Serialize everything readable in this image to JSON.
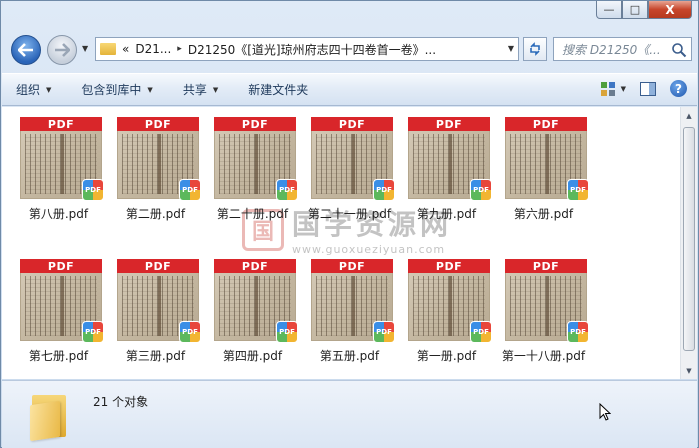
{
  "window": {
    "minimize_label": "—",
    "maximize_label": "□",
    "close_label": "X"
  },
  "address_bar": {
    "chevron": "«",
    "crumbs": [
      "D21...",
      "D21250《[道光]琼州府志四十四卷首一卷》..."
    ],
    "separator": "▸",
    "dropdown": "▼"
  },
  "search": {
    "placeholder": "搜索 D21250《..."
  },
  "toolbar": {
    "organize": "组织",
    "include_library": "包含到库中",
    "share": "共享",
    "new_folder": "新建文件夹",
    "caret": "▼",
    "help": "?"
  },
  "files": [
    {
      "name": "第八册.pdf",
      "banner": "PDF",
      "badge": "PDF"
    },
    {
      "name": "第二册.pdf",
      "banner": "PDF",
      "badge": "PDF"
    },
    {
      "name": "第二十册.pdf",
      "banner": "PDF",
      "badge": "PDF"
    },
    {
      "name": "第二十一册.pdf",
      "banner": "PDF",
      "badge": "PDF"
    },
    {
      "name": "第九册.pdf",
      "banner": "PDF",
      "badge": "PDF"
    },
    {
      "name": "第六册.pdf",
      "banner": "PDF",
      "badge": "PDF"
    },
    {
      "name": "第七册.pdf",
      "banner": "PDF",
      "badge": "PDF"
    },
    {
      "name": "第三册.pdf",
      "banner": "PDF",
      "badge": "PDF"
    },
    {
      "name": "第四册.pdf",
      "banner": "PDF",
      "badge": "PDF"
    },
    {
      "name": "第五册.pdf",
      "banner": "PDF",
      "badge": "PDF"
    },
    {
      "name": "第一册.pdf",
      "banner": "PDF",
      "badge": "PDF"
    },
    {
      "name": "第一十八册.pdf",
      "banner": "PDF",
      "badge": "PDF"
    }
  ],
  "watermark": {
    "seal": "国",
    "title": "国学资源网",
    "url": "www.guoxueziyuan.com"
  },
  "status": {
    "count_text": "21 个对象"
  },
  "colors": {
    "pdf_red": "#d9262a",
    "accent_blue": "#2a64b8"
  }
}
